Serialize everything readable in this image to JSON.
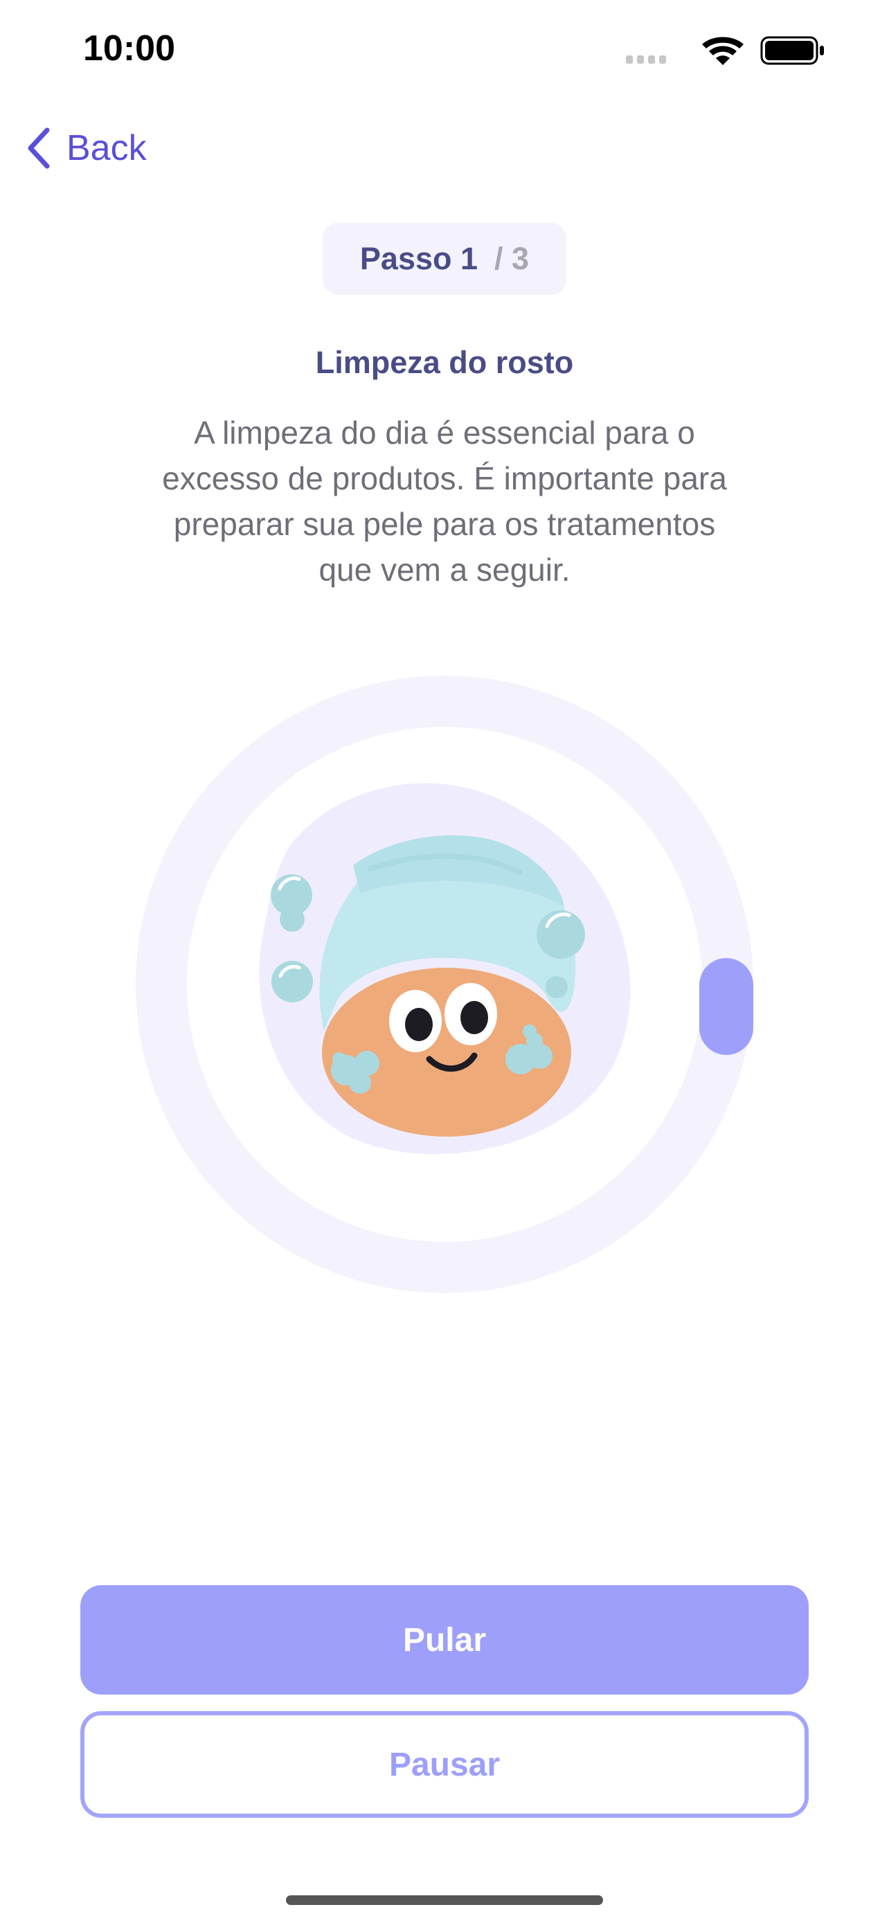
{
  "status_bar": {
    "time": "10:00",
    "icons": [
      "cellular-signal-icon",
      "wifi-icon",
      "battery-icon"
    ]
  },
  "nav": {
    "back_label": "Back",
    "back_icon": "chevron-left-icon"
  },
  "step": {
    "current": "Passo 1",
    "total": "/ 3",
    "title": "Limpeza do rosto",
    "description": "A limpeza do dia é essencial para o excesso de produtos. É importante para preparar sua pele para os tratamentos que vem a seguir."
  },
  "illustration": {
    "name": "face-wash-illustration"
  },
  "actions": {
    "skip_label": "Pular",
    "pause_label": "Pausar"
  },
  "colors": {
    "accent": "#9d9ffb",
    "accent_text": "#5a4fd6",
    "title": "#4a4c86",
    "body_text": "#6e6e78",
    "pill_bg": "#f4f3fd",
    "ring_track": "#f4f3fd"
  }
}
